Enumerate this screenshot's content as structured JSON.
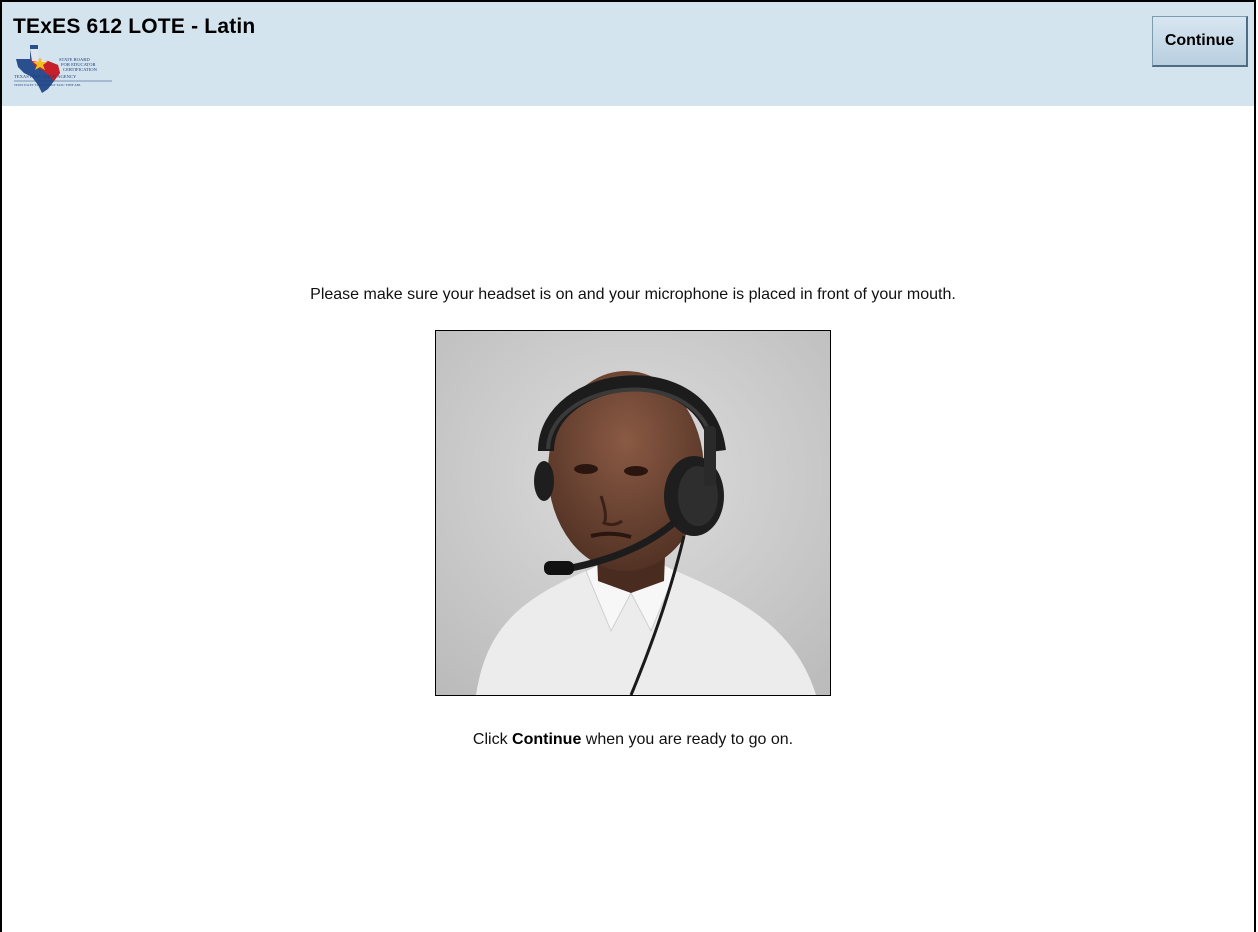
{
  "header": {
    "title": "TExES 612 LOTE - Latin",
    "continue_label": "Continue",
    "logo": {
      "line1": "STATE BOARD",
      "line2": "FOR EDUCATOR",
      "line3": "CERTIFICATION",
      "line4": "TEXAS EDUCATION AGENCY",
      "line5": "TExES·ExCET·TOPT·TExMaT·TASC·TSHP·ABL"
    }
  },
  "main": {
    "instruction": "Please make sure your headset is on and your microphone is placed in front of your mouth.",
    "footer_prefix": "Click ",
    "footer_bold": "Continue",
    "footer_suffix": " when you are ready to go on."
  },
  "colors": {
    "header_bg": "#d3e4ef",
    "button_bg": "#c4d8e6"
  }
}
